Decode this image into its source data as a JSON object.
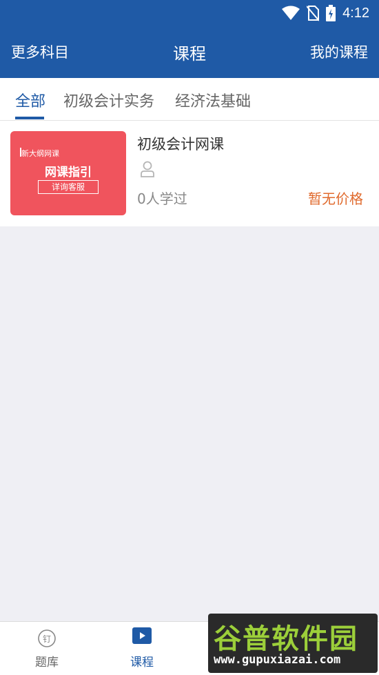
{
  "status_bar": {
    "time": "4:12"
  },
  "header": {
    "left_label": "更多科目",
    "title": "课程",
    "right_label": "我的课程"
  },
  "tabs": [
    {
      "label": "全部",
      "active": true
    },
    {
      "label": "初级会计实务",
      "active": false
    },
    {
      "label": "经济法基础",
      "active": false
    }
  ],
  "course": {
    "thumbnail": {
      "tag": "新大纲网课",
      "headline": "网课指引",
      "button": "详询客服"
    },
    "title": "初级会计网课",
    "learners": "0人学过",
    "price": "暂无价格"
  },
  "bottom_nav": {
    "items": [
      {
        "label": "题库",
        "icon": "question-bank-icon",
        "active": false
      },
      {
        "label": "课程",
        "icon": "play-video-icon",
        "active": true
      }
    ]
  },
  "watermark": {
    "text": "谷普软件园",
    "url": "www.gupuxiazai.com"
  },
  "colors": {
    "primary": "#1f5aa6",
    "price": "#e06a2d",
    "thumbnail": "#f0545d",
    "background": "#efeff4"
  }
}
